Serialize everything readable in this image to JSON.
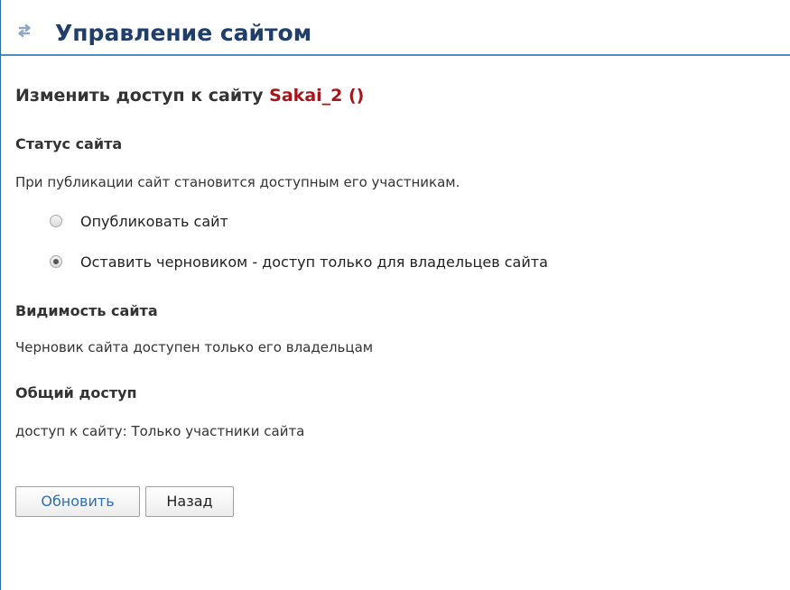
{
  "header": {
    "icon": "refresh-arrows-icon",
    "title": "Управление сайтом"
  },
  "page": {
    "heading_prefix": "Изменить доступ к сайту",
    "site_name": "Sakai_2 ()"
  },
  "status": {
    "title": "Статус сайта",
    "description": "При публикации сайт становится доступным его участникам.",
    "options": [
      {
        "label": "Опубликовать сайт",
        "checked": false
      },
      {
        "label": "Оставить черновиком - доступ только для владельцев сайта",
        "checked": true
      }
    ]
  },
  "visibility": {
    "title": "Видимость сайта",
    "text": "Черновик сайта доступен только его владельцам"
  },
  "access": {
    "title": "Общий доступ",
    "text": "доступ к сайту: Только участники сайта"
  },
  "actions": {
    "update_label": "Обновить",
    "back_label": "Назад"
  },
  "colors": {
    "title": "#1f3f6a",
    "site_name": "#a4161a",
    "accent_border": "#4a8fc4",
    "primary_button_text": "#2f6fb3"
  }
}
